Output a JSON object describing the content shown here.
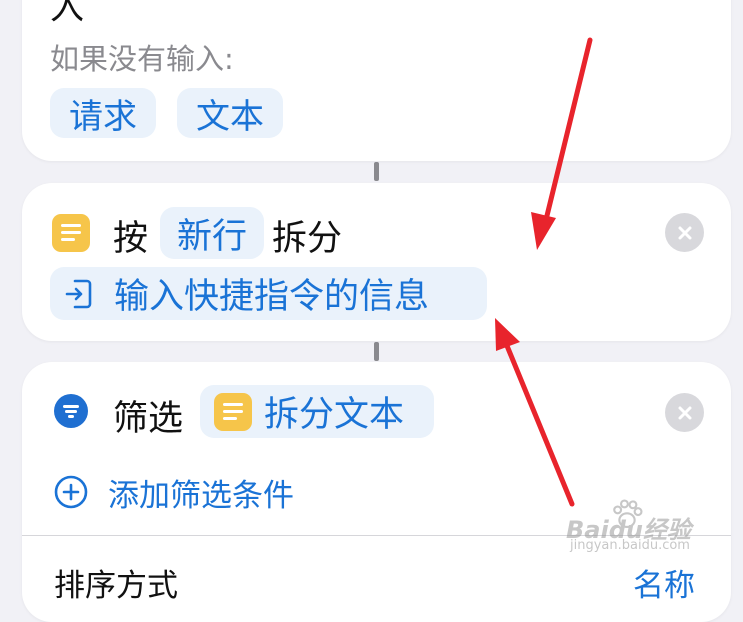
{
  "top_card": {
    "clipped_char": "入",
    "fallback_label": "如果没有输入:",
    "tokens": [
      "请求",
      "文本"
    ]
  },
  "split_action": {
    "verb": "按",
    "separator_token": "新行",
    "verb_suffix": "拆分",
    "input_token": "输入快捷指令的信息"
  },
  "filter_action": {
    "verb": "筛选",
    "source_token": "拆分文本",
    "add_condition_label": "添加筛选条件",
    "sort_label": "排序方式",
    "sort_value": "名称"
  },
  "watermark": {
    "brand": "Baidu经验",
    "url": "jingyan.baidu.com"
  },
  "colors": {
    "background": "#f1f1f6",
    "card": "#ffffff",
    "token_bg": "#eaf2fb",
    "token_text": "#1a73d6",
    "text_icon_yellow": "#f6c54a",
    "filter_icon_blue": "#1f6fd1",
    "annotation_arrow": "#e8242c"
  }
}
